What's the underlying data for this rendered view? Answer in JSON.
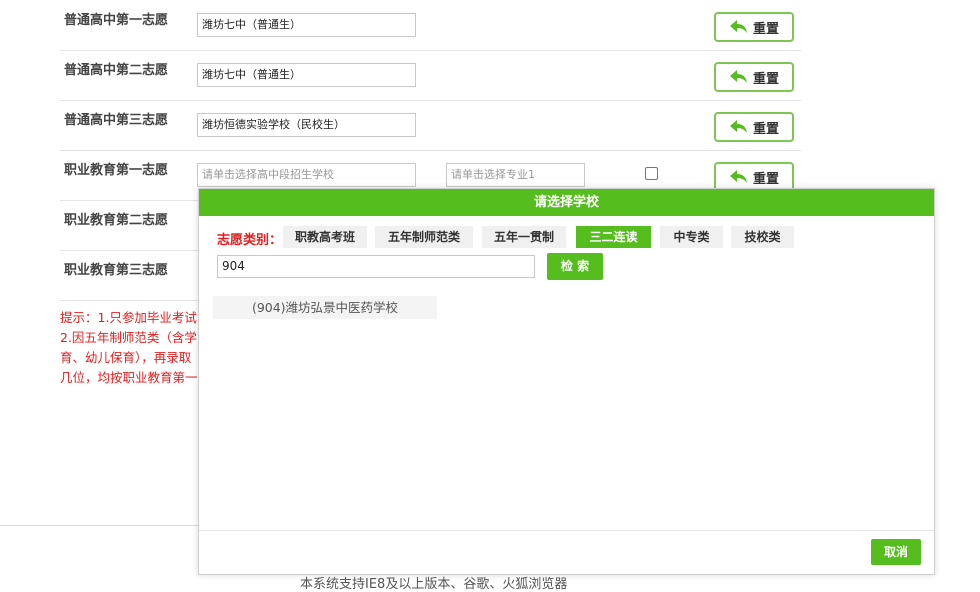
{
  "form": {
    "rows": [
      {
        "label": "普通高中第一志愿",
        "school": "潍坊七中（普通生）",
        "reset": "重置"
      },
      {
        "label": "普通高中第二志愿",
        "school": "潍坊七中（普通生）",
        "reset": "重置"
      },
      {
        "label": "普通高中第三志愿",
        "school": "潍坊恒德实验学校（民校生）",
        "reset": "重置"
      },
      {
        "label": "职业教育第一志愿",
        "school_placeholder": "请单击选择高中段招生学校",
        "major_placeholder": "请单击选择专业1",
        "reset": "重置"
      },
      {
        "label": "职业教育第二志愿"
      },
      {
        "label": "职业教育第三志愿"
      }
    ]
  },
  "tips": {
    "line1": "提示：1.只参加毕业考试",
    "line2": "2.因五年制师范类（含学",
    "line3": "育、幼儿保育），再录取",
    "line4": "几位，均按职业教育第一"
  },
  "footer": {
    "note": "本系统支持IE8及以上版本、谷歌、火狐浏览器"
  },
  "modal": {
    "title": "请选择学校",
    "category_label": "志愿类别：",
    "categories": [
      "职教高考班",
      "五年制师范类",
      "五年一贯制",
      "三二连读",
      "中专类",
      "技校类"
    ],
    "active_category": "三二连读",
    "search_value": "904",
    "search_button": "检 索",
    "results": [
      "(904)潍坊弘景中医药学校"
    ],
    "cancel_button": "取消"
  },
  "colors": {
    "accent": "#55bd1d",
    "reset_border": "#7ec553",
    "warning": "#e02020"
  },
  "icons": {
    "reset": "undo-arrow-icon",
    "checkbox": "checkbox"
  }
}
